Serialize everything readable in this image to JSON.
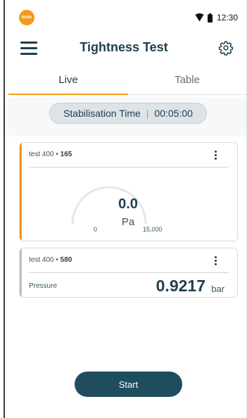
{
  "status_bar": {
    "logo_text": "testo",
    "time": "12:30",
    "icons": [
      "wifi-icon",
      "battery-icon"
    ]
  },
  "app_bar": {
    "title": "Tightness Test",
    "icons": [
      "menu-icon",
      "gear-icon"
    ]
  },
  "tabs": [
    {
      "label": "Live",
      "selected": true
    },
    {
      "label": "Table",
      "selected": false
    }
  ],
  "stabilisation": {
    "label": "Stabilisation Time",
    "separator": "|",
    "value": "00:05:00"
  },
  "cards": [
    {
      "device": "test 400",
      "dot": " • ",
      "id": "165",
      "gauge": {
        "value": "0.0",
        "unit": "Pa",
        "min": "0",
        "max": "15,000",
        "fill_fraction": 0.0
      },
      "accent": "#f39a1d"
    },
    {
      "device": "test 400",
      "dot": " • ",
      "id": "580",
      "label": "Pressure",
      "value": "0.9217",
      "unit": "bar",
      "accent": "#b7c3c9"
    }
  ],
  "start_button": {
    "label": "Start"
  },
  "colors": {
    "primary": "#1f4d5e",
    "accent": "#f39a1d",
    "text": "#1f3f4e",
    "pill_bg": "#dde3e6"
  }
}
